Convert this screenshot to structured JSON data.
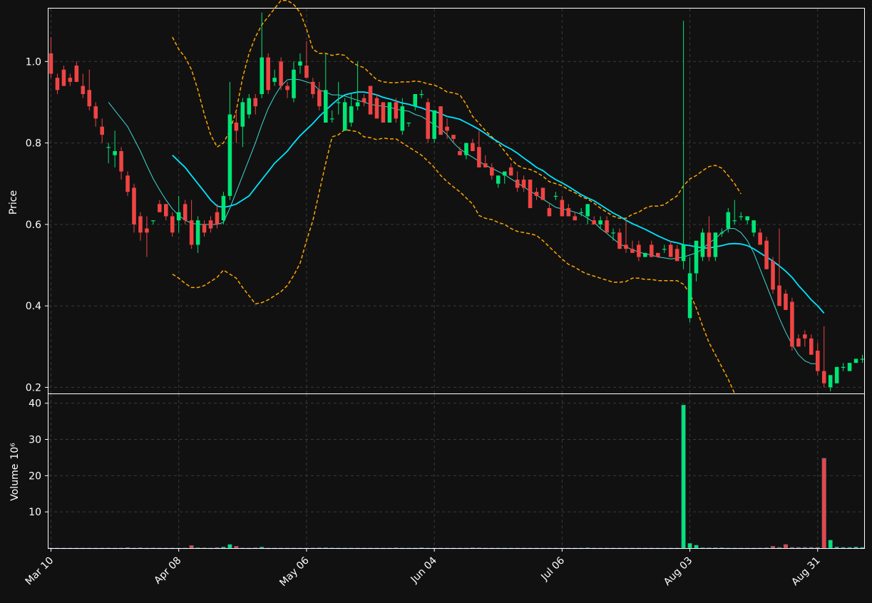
{
  "chart_data": {
    "type": "candlestick",
    "colors": {
      "background": "#111111",
      "up": "#00e676",
      "down": "#ef4444",
      "ma_fast": "#3fd8d0",
      "ma_slow": "#00e5ff",
      "bollinger": "#ffa500",
      "grid": "#3a3a3a",
      "text": "#ffffff"
    },
    "price_panel": {
      "ylabel": "Price",
      "ylim": [
        0.185,
        1.13
      ],
      "yticks": [
        0.2,
        0.4,
        0.6,
        0.8,
        1.0
      ],
      "ytick_labels": [
        "0.2",
        "0.4",
        "0.6",
        "0.8",
        "1.0"
      ]
    },
    "volume_panel": {
      "ylabel": "Volume",
      "yunit": "10⁶",
      "ylim": [
        0,
        42.5
      ],
      "yticks": [
        10,
        20,
        30,
        40
      ],
      "ytick_labels": [
        "10",
        "20",
        "30",
        "40"
      ]
    },
    "x_axis": {
      "n": 128,
      "ticks": [
        {
          "index": 0,
          "label": "Mar 10"
        },
        {
          "index": 20,
          "label": "Apr 08"
        },
        {
          "index": 40,
          "label": "May 06"
        },
        {
          "index": 60,
          "label": "Jun 04"
        },
        {
          "index": 80,
          "label": "Jul 06"
        },
        {
          "index": 100,
          "label": "Aug 03"
        },
        {
          "index": 120,
          "label": "Aug 31"
        }
      ]
    },
    "candles": [
      [
        1.02,
        1.06,
        0.96,
        0.97
      ],
      [
        0.96,
        0.97,
        0.92,
        0.93
      ],
      [
        0.98,
        0.99,
        0.94,
        0.94
      ],
      [
        0.96,
        0.97,
        0.94,
        0.95
      ],
      [
        0.99,
        1.0,
        0.95,
        0.95
      ],
      [
        0.94,
        0.97,
        0.91,
        0.92
      ],
      [
        0.93,
        0.98,
        0.88,
        0.89
      ],
      [
        0.89,
        0.9,
        0.84,
        0.86
      ],
      [
        0.84,
        0.86,
        0.8,
        0.82
      ],
      [
        0.79,
        0.8,
        0.75,
        0.79
      ],
      [
        0.77,
        0.83,
        0.74,
        0.78
      ],
      [
        0.78,
        0.79,
        0.71,
        0.73
      ],
      [
        0.72,
        0.73,
        0.67,
        0.68
      ],
      [
        0.69,
        0.7,
        0.58,
        0.6
      ],
      [
        0.62,
        0.63,
        0.56,
        0.58
      ],
      [
        0.59,
        0.62,
        0.52,
        0.58
      ],
      [
        0.61,
        0.61,
        0.6,
        0.61
      ],
      [
        0.65,
        0.66,
        0.63,
        0.63
      ],
      [
        0.65,
        0.65,
        0.61,
        0.62
      ],
      [
        0.62,
        0.63,
        0.57,
        0.58
      ],
      [
        0.61,
        0.67,
        0.58,
        0.63
      ],
      [
        0.65,
        0.66,
        0.6,
        0.61
      ],
      [
        0.61,
        0.66,
        0.54,
        0.55
      ],
      [
        0.55,
        0.62,
        0.53,
        0.61
      ],
      [
        0.6,
        0.61,
        0.57,
        0.58
      ],
      [
        0.61,
        0.62,
        0.58,
        0.59
      ],
      [
        0.63,
        0.65,
        0.59,
        0.6
      ],
      [
        0.61,
        0.68,
        0.6,
        0.67
      ],
      [
        0.67,
        0.95,
        0.66,
        0.87
      ],
      [
        0.85,
        0.88,
        0.8,
        0.83
      ],
      [
        0.84,
        0.91,
        0.79,
        0.9
      ],
      [
        0.87,
        0.92,
        0.86,
        0.91
      ],
      [
        0.91,
        0.92,
        0.87,
        0.89
      ],
      [
        0.92,
        1.12,
        0.91,
        1.01
      ],
      [
        1.01,
        1.02,
        0.92,
        0.93
      ],
      [
        0.95,
        0.98,
        0.94,
        0.96
      ],
      [
        1.0,
        1.01,
        0.93,
        0.94
      ],
      [
        0.94,
        0.95,
        0.91,
        0.93
      ],
      [
        0.91,
        1.0,
        0.9,
        0.98
      ],
      [
        0.99,
        1.02,
        0.97,
        1.0
      ],
      [
        0.99,
        1.05,
        0.96,
        0.96
      ],
      [
        0.95,
        0.96,
        0.91,
        0.92
      ],
      [
        0.93,
        0.95,
        0.88,
        0.89
      ],
      [
        0.85,
        1.02,
        0.85,
        0.93
      ],
      [
        0.86,
        0.88,
        0.85,
        0.86
      ],
      [
        0.9,
        0.95,
        0.87,
        0.9
      ],
      [
        0.83,
        0.91,
        0.83,
        0.9
      ],
      [
        0.85,
        0.92,
        0.84,
        0.89
      ],
      [
        0.89,
        1.0,
        0.88,
        0.9
      ],
      [
        0.91,
        0.92,
        0.89,
        0.9
      ],
      [
        0.94,
        0.94,
        0.87,
        0.87
      ],
      [
        0.91,
        0.92,
        0.86,
        0.86
      ],
      [
        0.9,
        0.9,
        0.85,
        0.85
      ],
      [
        0.85,
        0.9,
        0.85,
        0.9
      ],
      [
        0.9,
        0.91,
        0.85,
        0.86
      ],
      [
        0.83,
        0.91,
        0.82,
        0.89
      ],
      [
        0.85,
        0.85,
        0.84,
        0.85
      ],
      [
        0.89,
        0.92,
        0.88,
        0.92
      ],
      [
        0.92,
        0.93,
        0.91,
        0.92
      ],
      [
        0.9,
        0.91,
        0.8,
        0.81
      ],
      [
        0.81,
        0.88,
        0.8,
        0.88
      ],
      [
        0.89,
        0.89,
        0.82,
        0.82
      ],
      [
        0.84,
        0.86,
        0.81,
        0.83
      ],
      [
        0.82,
        0.82,
        0.8,
        0.81
      ],
      [
        0.78,
        0.79,
        0.77,
        0.77
      ],
      [
        0.77,
        0.8,
        0.76,
        0.8
      ],
      [
        0.8,
        0.81,
        0.78,
        0.78
      ],
      [
        0.79,
        0.83,
        0.74,
        0.74
      ],
      [
        0.75,
        0.77,
        0.74,
        0.74
      ],
      [
        0.74,
        0.75,
        0.71,
        0.72
      ],
      [
        0.7,
        0.72,
        0.69,
        0.72
      ],
      [
        0.72,
        0.73,
        0.7,
        0.73
      ],
      [
        0.74,
        0.75,
        0.72,
        0.72
      ],
      [
        0.71,
        0.73,
        0.68,
        0.69
      ],
      [
        0.71,
        0.72,
        0.68,
        0.69
      ],
      [
        0.71,
        0.71,
        0.64,
        0.64
      ],
      [
        0.68,
        0.69,
        0.66,
        0.67
      ],
      [
        0.69,
        0.69,
        0.66,
        0.66
      ],
      [
        0.64,
        0.65,
        0.62,
        0.62
      ],
      [
        0.67,
        0.68,
        0.66,
        0.67
      ],
      [
        0.66,
        0.67,
        0.62,
        0.62
      ],
      [
        0.64,
        0.65,
        0.62,
        0.62
      ],
      [
        0.62,
        0.63,
        0.61,
        0.61
      ],
      [
        0.63,
        0.64,
        0.62,
        0.63
      ],
      [
        0.62,
        0.65,
        0.6,
        0.65
      ],
      [
        0.61,
        0.62,
        0.6,
        0.6
      ],
      [
        0.6,
        0.62,
        0.59,
        0.61
      ],
      [
        0.61,
        0.62,
        0.58,
        0.58
      ],
      [
        0.58,
        0.59,
        0.56,
        0.58
      ],
      [
        0.58,
        0.59,
        0.54,
        0.54
      ],
      [
        0.55,
        0.61,
        0.53,
        0.54
      ],
      [
        0.54,
        0.56,
        0.53,
        0.53
      ],
      [
        0.55,
        0.56,
        0.51,
        0.52
      ],
      [
        0.52,
        0.53,
        0.52,
        0.53
      ],
      [
        0.55,
        0.56,
        0.52,
        0.52
      ],
      [
        0.53,
        0.53,
        0.52,
        0.52
      ],
      [
        0.54,
        0.55,
        0.53,
        0.54
      ],
      [
        0.55,
        0.56,
        0.52,
        0.52
      ],
      [
        0.54,
        0.55,
        0.51,
        0.51
      ],
      [
        0.51,
        1.1,
        0.49,
        0.55
      ],
      [
        0.37,
        0.52,
        0.36,
        0.48
      ],
      [
        0.48,
        0.53,
        0.46,
        0.56
      ],
      [
        0.52,
        0.59,
        0.51,
        0.58
      ],
      [
        0.58,
        0.62,
        0.51,
        0.52
      ],
      [
        0.52,
        0.58,
        0.51,
        0.58
      ],
      [
        0.58,
        0.59,
        0.57,
        0.58
      ],
      [
        0.59,
        0.64,
        0.58,
        0.63
      ],
      [
        0.61,
        0.66,
        0.6,
        0.61
      ],
      [
        0.62,
        0.63,
        0.61,
        0.62
      ],
      [
        0.61,
        0.62,
        0.6,
        0.62
      ],
      [
        0.58,
        0.61,
        0.57,
        0.61
      ],
      [
        0.58,
        0.59,
        0.55,
        0.55
      ],
      [
        0.56,
        0.57,
        0.49,
        0.49
      ],
      [
        0.51,
        0.52,
        0.43,
        0.44
      ],
      [
        0.45,
        0.59,
        0.4,
        0.4
      ],
      [
        0.43,
        0.44,
        0.39,
        0.39
      ],
      [
        0.41,
        0.42,
        0.29,
        0.3
      ],
      [
        0.32,
        0.33,
        0.3,
        0.3
      ],
      [
        0.33,
        0.34,
        0.3,
        0.32
      ],
      [
        0.32,
        0.33,
        0.28,
        0.28
      ],
      [
        0.29,
        0.31,
        0.23,
        0.24
      ],
      [
        0.24,
        0.35,
        0.2,
        0.21
      ],
      [
        0.2,
        0.23,
        0.19,
        0.23
      ],
      [
        0.21,
        0.25,
        0.21,
        0.25
      ],
      [
        0.25,
        0.26,
        0.24,
        0.25
      ],
      [
        0.24,
        0.26,
        0.24,
        0.26
      ],
      [
        0.26,
        0.27,
        0.26,
        0.27
      ],
      [
        0.27,
        0.28,
        0.26,
        0.27
      ]
    ],
    "volume": [
      0.02,
      0.02,
      0.02,
      0.02,
      0.02,
      0.02,
      0.02,
      0.02,
      0.02,
      0.05,
      0.02,
      0.02,
      0.15,
      0.02,
      0.1,
      0.02,
      0.05,
      0.02,
      0.02,
      0.02,
      0.02,
      0.02,
      0.7,
      0.1,
      0.08,
      0.02,
      0.15,
      0.3,
      1.0,
      0.5,
      0.05,
      0.02,
      0.1,
      0.3,
      0.02,
      0.02,
      0.02,
      0.02,
      0.02,
      0.02,
      0.02,
      0.05,
      0.1,
      0.1,
      0.05,
      0.02,
      0.02,
      0.02,
      0.02,
      0.02,
      0.02,
      0.02,
      0.02,
      0.02,
      0.1,
      0.02,
      0.02,
      0.02,
      0.1,
      0.02,
      0.02,
      0.02,
      0.02,
      0.02,
      0.02,
      0.02,
      0.1,
      0.08,
      0.02,
      0.02,
      0.02,
      0.02,
      0.02,
      0.02,
      0.02,
      0.02,
      0.02,
      0.02,
      0.02,
      0.02,
      0.02,
      0.02,
      0.02,
      0.02,
      0.1,
      0.02,
      0.02,
      0.02,
      0.02,
      0.02,
      0.02,
      0.02,
      0.02,
      0.02,
      0.02,
      0.02,
      0.02,
      0.02,
      0.02,
      39.5,
      1.3,
      0.8,
      0.1,
      0.1,
      0.1,
      0.1,
      0.02,
      0.02,
      0.02,
      0.02,
      0.02,
      0.05,
      0.1,
      0.5,
      0.2,
      1.0,
      0.2,
      0.2,
      0.2,
      0.2,
      0.2,
      24.8,
      2.2,
      0.3,
      0.2,
      0.2,
      0.3,
      0.2
    ],
    "ma_fast": {
      "start": 9,
      "values": [
        0.9,
        0.88,
        0.86,
        0.84,
        0.81,
        0.78,
        0.745,
        0.712,
        0.685,
        0.66,
        0.638,
        0.622,
        0.61,
        0.603,
        0.6,
        0.6,
        0.6,
        0.6,
        0.605,
        0.64,
        0.68,
        0.72,
        0.76,
        0.8,
        0.845,
        0.885,
        0.915,
        0.94,
        0.955,
        0.957,
        0.955,
        0.95,
        0.945,
        0.93,
        0.925,
        0.918,
        0.918,
        0.915,
        0.91,
        0.905,
        0.9,
        0.895,
        0.892,
        0.89,
        0.888,
        0.883,
        0.88,
        0.878,
        0.87,
        0.865,
        0.855,
        0.845,
        0.835,
        0.82,
        0.8,
        0.785,
        0.775,
        0.765,
        0.755,
        0.745,
        0.738,
        0.73,
        0.722,
        0.712,
        0.702,
        0.692,
        0.682,
        0.672,
        0.662,
        0.652,
        0.642,
        0.638,
        0.635,
        0.63,
        0.625,
        0.615,
        0.605,
        0.59,
        0.578,
        0.565,
        0.552,
        0.545,
        0.538,
        0.532,
        0.528,
        0.525,
        0.52,
        0.518,
        0.515,
        0.517,
        0.52,
        0.525,
        0.53,
        0.54,
        0.555,
        0.565,
        0.58,
        0.59,
        0.59,
        0.58,
        0.56,
        0.53,
        0.49,
        0.45,
        0.41,
        0.37,
        0.335,
        0.305,
        0.28,
        0.265,
        0.258,
        0.258
      ]
    },
    "ma_slow": {
      "start": 19,
      "values": [
        0.77,
        0.755,
        0.74,
        0.72,
        0.7,
        0.68,
        0.66,
        0.645,
        0.642,
        0.645,
        0.65,
        0.66,
        0.67,
        0.69,
        0.71,
        0.73,
        0.75,
        0.765,
        0.78,
        0.8,
        0.818,
        0.833,
        0.848,
        0.865,
        0.88,
        0.895,
        0.908,
        0.918,
        0.922,
        0.925,
        0.925,
        0.922,
        0.918,
        0.912,
        0.908,
        0.903,
        0.898,
        0.895,
        0.89,
        0.886,
        0.88,
        0.878,
        0.872,
        0.865,
        0.862,
        0.858,
        0.85,
        0.842,
        0.833,
        0.823,
        0.812,
        0.803,
        0.793,
        0.785,
        0.775,
        0.763,
        0.752,
        0.74,
        0.732,
        0.72,
        0.71,
        0.702,
        0.693,
        0.683,
        0.673,
        0.665,
        0.658,
        0.648,
        0.638,
        0.628,
        0.62,
        0.61,
        0.602,
        0.595,
        0.588,
        0.58,
        0.572,
        0.565,
        0.558,
        0.555,
        0.55,
        0.548,
        0.545,
        0.542,
        0.542,
        0.545,
        0.548,
        0.552,
        0.553,
        0.552,
        0.548,
        0.54,
        0.53,
        0.52,
        0.51,
        0.498,
        0.485,
        0.47,
        0.45,
        0.433,
        0.415,
        0.4,
        0.382
      ]
    },
    "bollinger_upper": {
      "start": 19,
      "values": [
        1.06,
        1.03,
        1.01,
        0.98,
        0.93,
        0.87,
        0.82,
        0.79,
        0.8,
        0.83,
        0.88,
        0.96,
        1.02,
        1.06,
        1.09,
        1.11,
        1.13,
        1.15,
        1.15,
        1.14,
        1.12,
        1.08,
        1.03,
        1.02,
        1.02,
        1.015,
        1.018,
        1.015,
        1.0,
        0.99,
        0.985,
        0.97,
        0.955,
        0.95,
        0.948,
        0.948,
        0.95,
        0.95,
        0.952,
        0.95,
        0.945,
        0.942,
        0.935,
        0.925,
        0.923,
        0.918,
        0.895,
        0.865,
        0.848,
        0.83,
        0.815,
        0.8,
        0.78,
        0.76,
        0.745,
        0.738,
        0.735,
        0.728,
        0.718,
        0.705,
        0.7,
        0.695,
        0.685,
        0.678,
        0.668,
        0.662,
        0.652,
        0.64,
        0.63,
        0.62,
        0.615,
        0.615,
        0.625,
        0.63,
        0.64,
        0.645,
        0.645,
        0.648,
        0.66,
        0.67,
        0.695,
        0.712,
        0.72,
        0.732,
        0.742,
        0.745,
        0.738,
        0.72,
        0.7,
        0.675
      ]
    },
    "bollinger_lower": {
      "start": 19,
      "values": [
        0.478,
        0.468,
        0.455,
        0.445,
        0.445,
        0.45,
        0.46,
        0.47,
        0.488,
        0.478,
        0.468,
        0.445,
        0.425,
        0.405,
        0.408,
        0.415,
        0.425,
        0.435,
        0.45,
        0.475,
        0.505,
        0.56,
        0.61,
        0.68,
        0.75,
        0.815,
        0.82,
        0.833,
        0.83,
        0.828,
        0.815,
        0.813,
        0.808,
        0.812,
        0.81,
        0.81,
        0.8,
        0.79,
        0.78,
        0.77,
        0.755,
        0.74,
        0.72,
        0.705,
        0.692,
        0.68,
        0.665,
        0.65,
        0.622,
        0.615,
        0.612,
        0.605,
        0.6,
        0.59,
        0.583,
        0.58,
        0.577,
        0.573,
        0.56,
        0.545,
        0.53,
        0.515,
        0.502,
        0.495,
        0.485,
        0.478,
        0.473,
        0.468,
        0.463,
        0.458,
        0.458,
        0.46,
        0.468,
        0.468,
        0.465,
        0.465,
        0.462,
        0.462,
        0.462,
        0.462,
        0.453,
        0.43,
        0.395,
        0.35,
        0.31,
        0.28,
        0.25,
        0.22,
        0.185
      ]
    }
  }
}
